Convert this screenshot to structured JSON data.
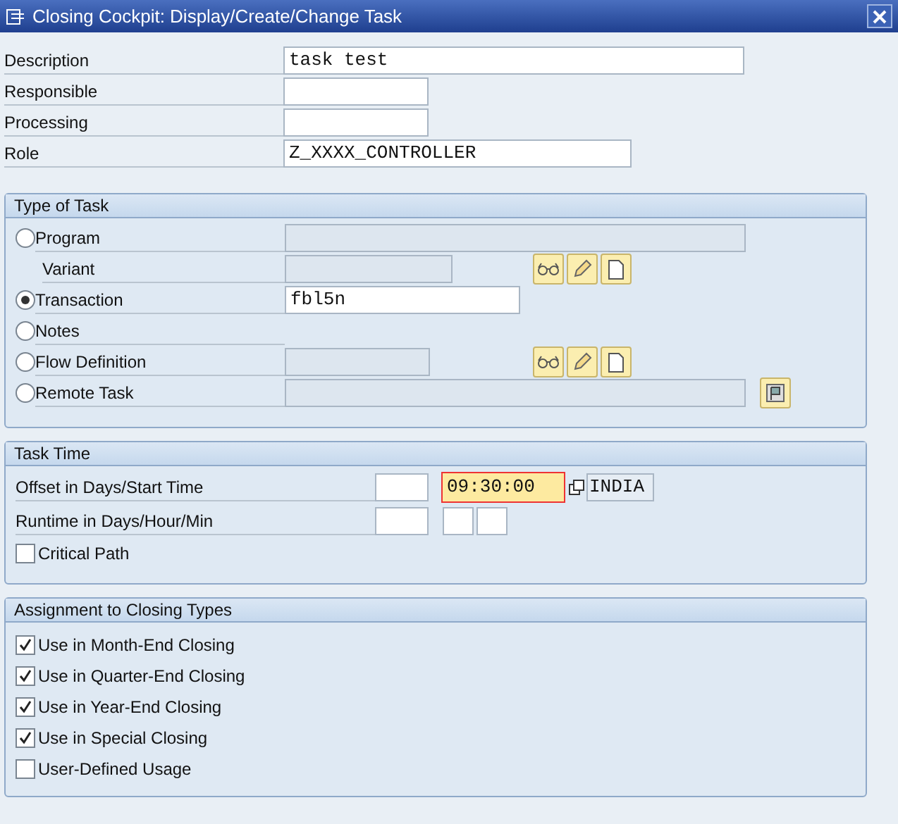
{
  "window": {
    "title": "Closing Cockpit: Display/Create/Change Task"
  },
  "header_fields": [
    {
      "label": "Description",
      "value": "task test"
    },
    {
      "label": "Responsible"
    },
    {
      "label": "Processing"
    },
    {
      "label": "Role",
      "value": "Z_XXXX_CONTROLLER"
    }
  ],
  "type_of_task": {
    "title": "Type of Task",
    "rows": [
      {
        "kind": "radio",
        "label": "Program",
        "selected": false,
        "field": {
          "disabled": true
        }
      },
      {
        "kind": "subitem",
        "label": "Variant",
        "field": {
          "disabled": true
        }
      },
      {
        "kind": "radio",
        "label": "Transaction",
        "selected": true,
        "field": {
          "value": "fbl5n",
          "disabled": false
        }
      },
      {
        "kind": "radio",
        "label": "Notes",
        "selected": false
      },
      {
        "kind": "flow",
        "label": "Flow Definition",
        "selected": false,
        "field": {
          "disabled": true
        }
      },
      {
        "kind": "remote",
        "label": "Remote Task",
        "selected": false,
        "field": {
          "disabled": true
        }
      }
    ]
  },
  "task_time": {
    "title": "Task Time",
    "offset": {
      "label": "Offset in Days/Start Time",
      "time": "09:30:00",
      "time_focused": true,
      "timezone": "INDIA"
    },
    "runtime": {
      "label": "Runtime in Days/Hour/Min"
    },
    "critical_path": {
      "label": "Critical Path",
      "checked": false
    }
  },
  "closing_types": {
    "title": "Assignment to Closing Types",
    "items": [
      {
        "label": "Use in Month-End Closing",
        "checked": true
      },
      {
        "label": "Use in Quarter-End Closing",
        "checked": true
      },
      {
        "label": "Use in Year-End Closing",
        "checked": true
      },
      {
        "label": "Use in Special Closing",
        "checked": true
      },
      {
        "label": "User-Defined Usage",
        "checked": false
      }
    ]
  }
}
